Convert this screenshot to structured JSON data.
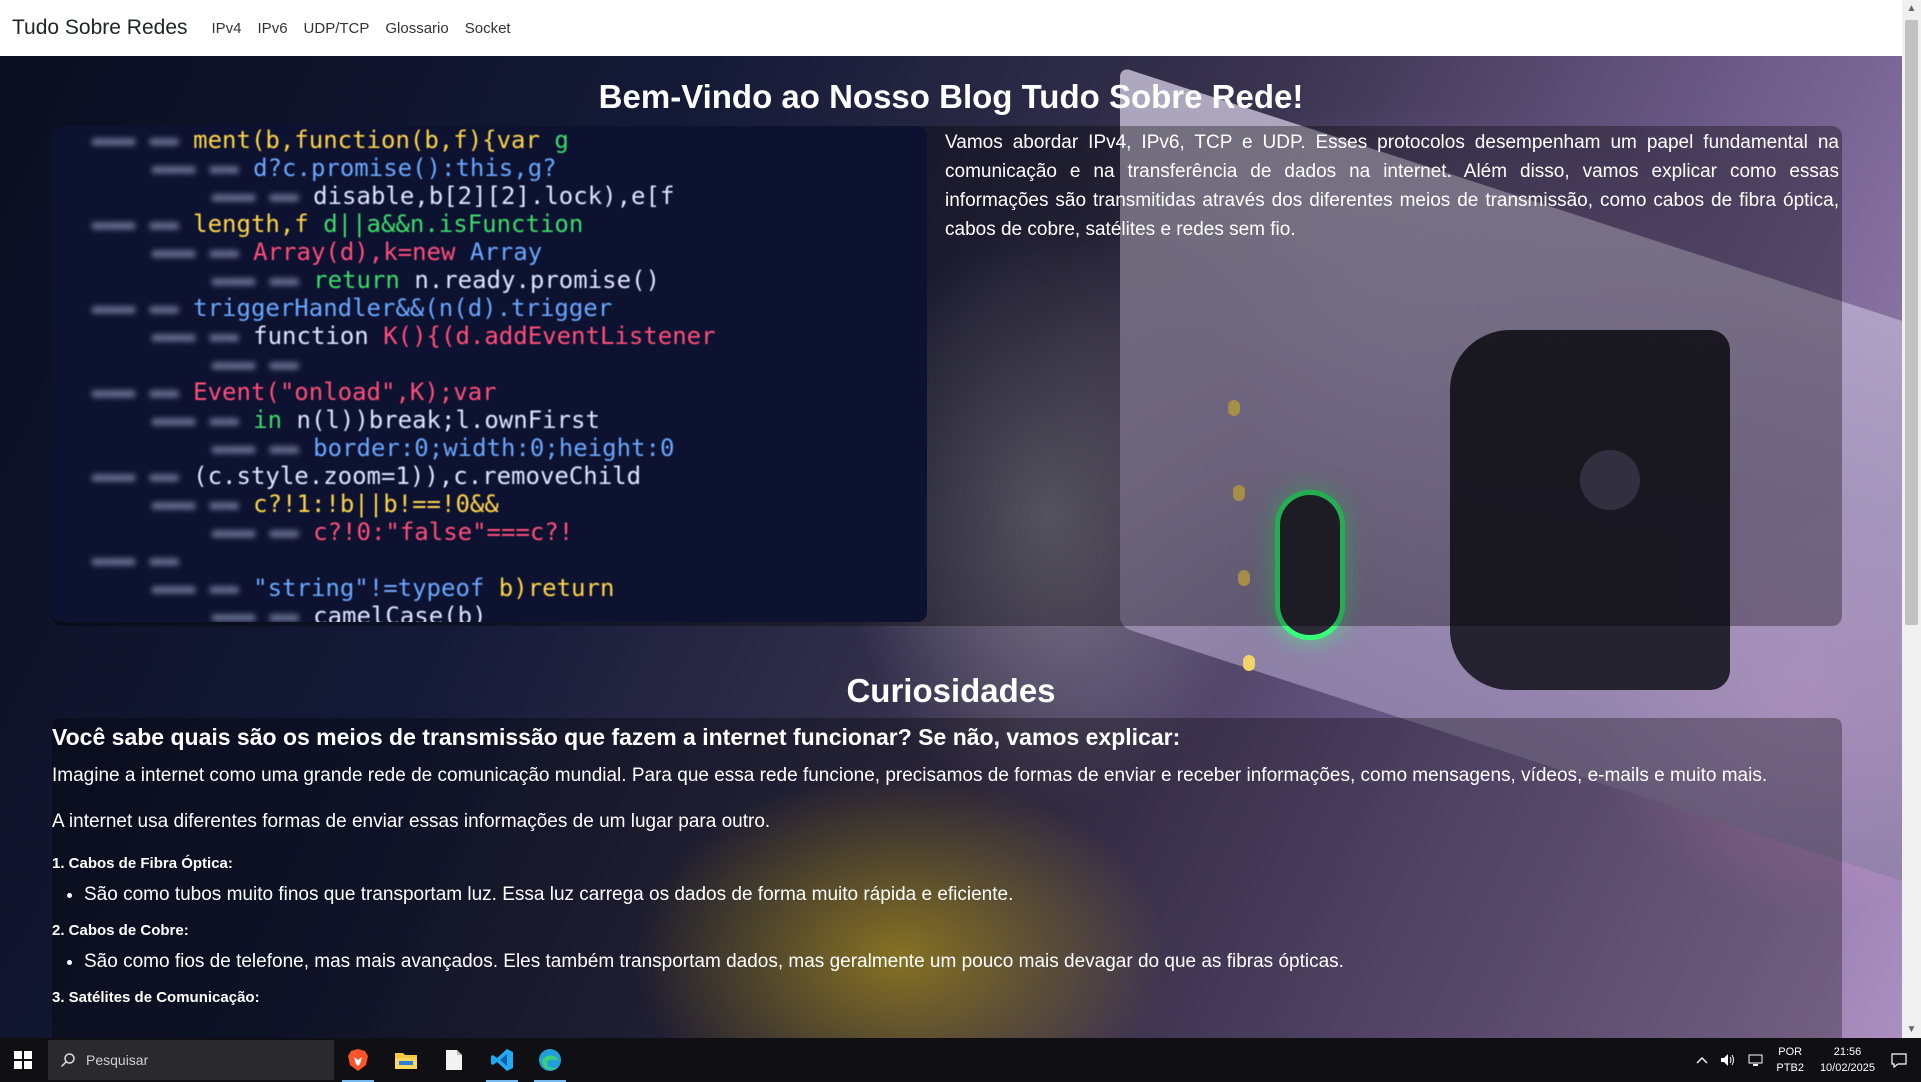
{
  "navbar": {
    "brand": "Tudo Sobre Redes",
    "links": [
      "IPv4",
      "IPv6",
      "UDP/TCP",
      "Glossario",
      "Socket"
    ]
  },
  "hero": {
    "title": "Bem-Vindo ao Nosso Blog Tudo Sobre Rede!",
    "intro": "Vamos abordar IPv4, IPv6, TCP e UDP. Esses protocolos desempenham um papel fundamental na comunicação e na transferência de dados na internet. Além disso, vamos explicar como essas informações são transmitidas através dos diferentes meios de transmissão, como cabos de fibra óptica, cabos de cobre, satélites e redes sem fio."
  },
  "curiosidades": {
    "title": "Curiosidades",
    "question": "Você sabe quais são os meios de transmissão que fazem a internet funcionar? Se não, vamos explicar:",
    "paragraph1": "Imagine a internet como uma grande rede de comunicação mundial. Para que essa rede funcione, precisamos de formas de enviar e receber informações, como mensagens, vídeos, e-mails e muito mais.",
    "paragraph2": "A internet usa diferentes formas de enviar essas informações de um lugar para outro.",
    "items": [
      {
        "heading": "1. Cabos de Fibra Óptica:",
        "bullet": "São como tubos muito finos que transportam luz. Essa luz carrega os dados de forma muito rápida e eficiente."
      },
      {
        "heading": "2. Cabos de Cobre:",
        "bullet": "São como fios de telefone, mas mais avançados. Eles também transportam dados, mas geralmente um pouco mais devagar do que as fibras ópticas."
      },
      {
        "heading": "3. Satélites de Comunicação:",
        "bullet": ""
      }
    ]
  },
  "code_image": {
    "lines": [
      "ment(b,function(b,f){var g",
      "  d?c.promise():this,g?",
      "  disable,b[2][2].lock),e[f",
      "  length,f   d||a&&n.isFunction",
      "  Array(d),k=new Array",
      "  return n.ready.promise()",
      "  triggerHandler&&(n(d).trigger",
      "  function K(){(d.addEventListener",
      "",
      "  Event(\"onload\",K);var",
      "  in n(l))break;l.ownFirst",
      "  border:0;width:0;height:0",
      "  (c.style.zoom=1)),c.removeChild",
      "  c?!1:!b||b!==!0&&",
      "  c?!0:\"false\"===c?!",
      "",
      "  \"string\"!=typeof b)return",
      "  camelCase(b)"
    ]
  },
  "taskbar": {
    "search_placeholder": "Pesquisar",
    "language": "POR",
    "keyboard": "PTB2",
    "time": "21:56",
    "date": "10/02/2025",
    "apps": [
      "brave-browser",
      "file-explorer",
      "notepad",
      "vscode",
      "edge"
    ]
  },
  "colors": {
    "accent": "#76b9ed",
    "taskbar": "#101014",
    "navbar": "#ffffff"
  }
}
